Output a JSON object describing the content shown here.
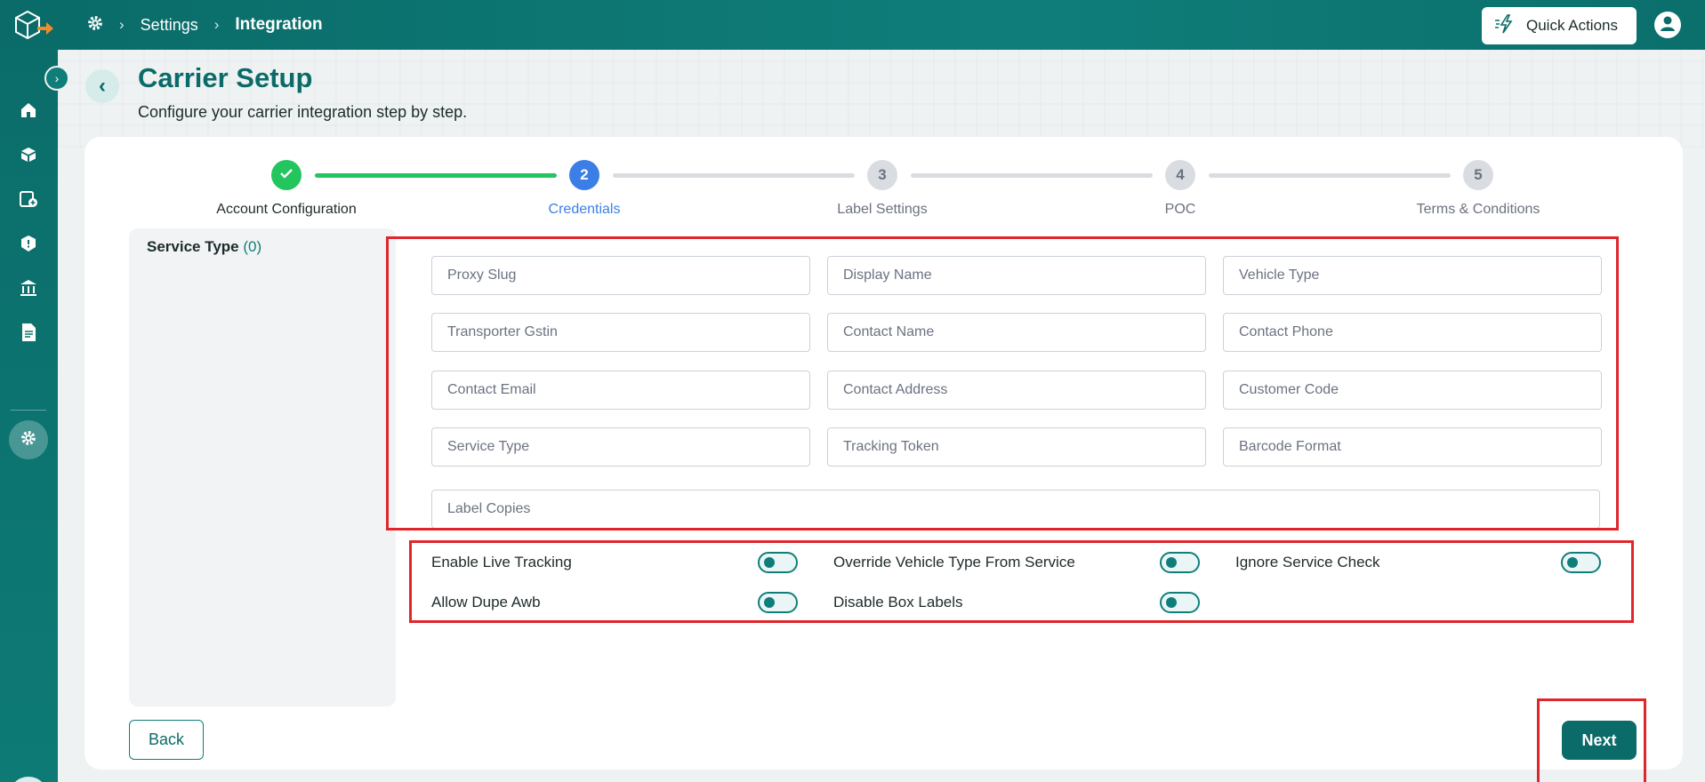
{
  "header": {
    "breadcrumb_settings": "Settings",
    "breadcrumb_current": "Integration",
    "quick_actions_label": "Quick Actions"
  },
  "page": {
    "title": "Carrier Setup",
    "subtitle": "Configure your carrier integration step by step."
  },
  "stepper": {
    "steps": [
      {
        "number": "1",
        "label": "Account Configuration",
        "state": "done"
      },
      {
        "number": "2",
        "label": "Credentials",
        "state": "active"
      },
      {
        "number": "3",
        "label": "Label Settings",
        "state": "todo"
      },
      {
        "number": "4",
        "label": "POC",
        "state": "todo"
      },
      {
        "number": "5",
        "label": "Terms & Conditions",
        "state": "todo"
      }
    ]
  },
  "service_panel": {
    "title": "Service Type",
    "count": "(0)"
  },
  "form": {
    "fields": [
      {
        "placeholder": "Proxy Slug",
        "value": ""
      },
      {
        "placeholder": "Display Name",
        "value": ""
      },
      {
        "placeholder": "Vehicle Type",
        "value": ""
      },
      {
        "placeholder": "Transporter Gstin",
        "value": ""
      },
      {
        "placeholder": "Contact Name",
        "value": ""
      },
      {
        "placeholder": "Contact Phone",
        "value": ""
      },
      {
        "placeholder": "Contact Email",
        "value": ""
      },
      {
        "placeholder": "Contact Address",
        "value": ""
      },
      {
        "placeholder": "Customer Code",
        "value": ""
      },
      {
        "placeholder": "Service Type",
        "value": ""
      },
      {
        "placeholder": "Tracking Token",
        "value": ""
      },
      {
        "placeholder": "Barcode Format",
        "value": ""
      },
      {
        "placeholder": "Label Copies",
        "value": ""
      }
    ]
  },
  "toggles": [
    {
      "label": "Enable Live Tracking",
      "on": false
    },
    {
      "label": "Override Vehicle Type From Service",
      "on": false
    },
    {
      "label": "Ignore Service Check",
      "on": false
    },
    {
      "label": "Allow Dupe Awb",
      "on": false
    },
    {
      "label": "Disable Box Labels",
      "on": false
    }
  ],
  "actions": {
    "back_label": "Back",
    "next_label": "Next"
  },
  "colors": {
    "brand": "#0b6b68",
    "step_done": "#22c55e",
    "step_active": "#3b7fe6",
    "highlight": "#e0262c"
  },
  "icons": {
    "logo": "box-arrow-logo",
    "breadcrumb_root": "gear-icon",
    "quick_actions": "lightning-icon",
    "profile": "user-icon",
    "sidebar": [
      "home-icon",
      "box-icon",
      "add-document-icon",
      "shield-icon",
      "bank-icon",
      "report-icon",
      "gear-icon"
    ]
  }
}
